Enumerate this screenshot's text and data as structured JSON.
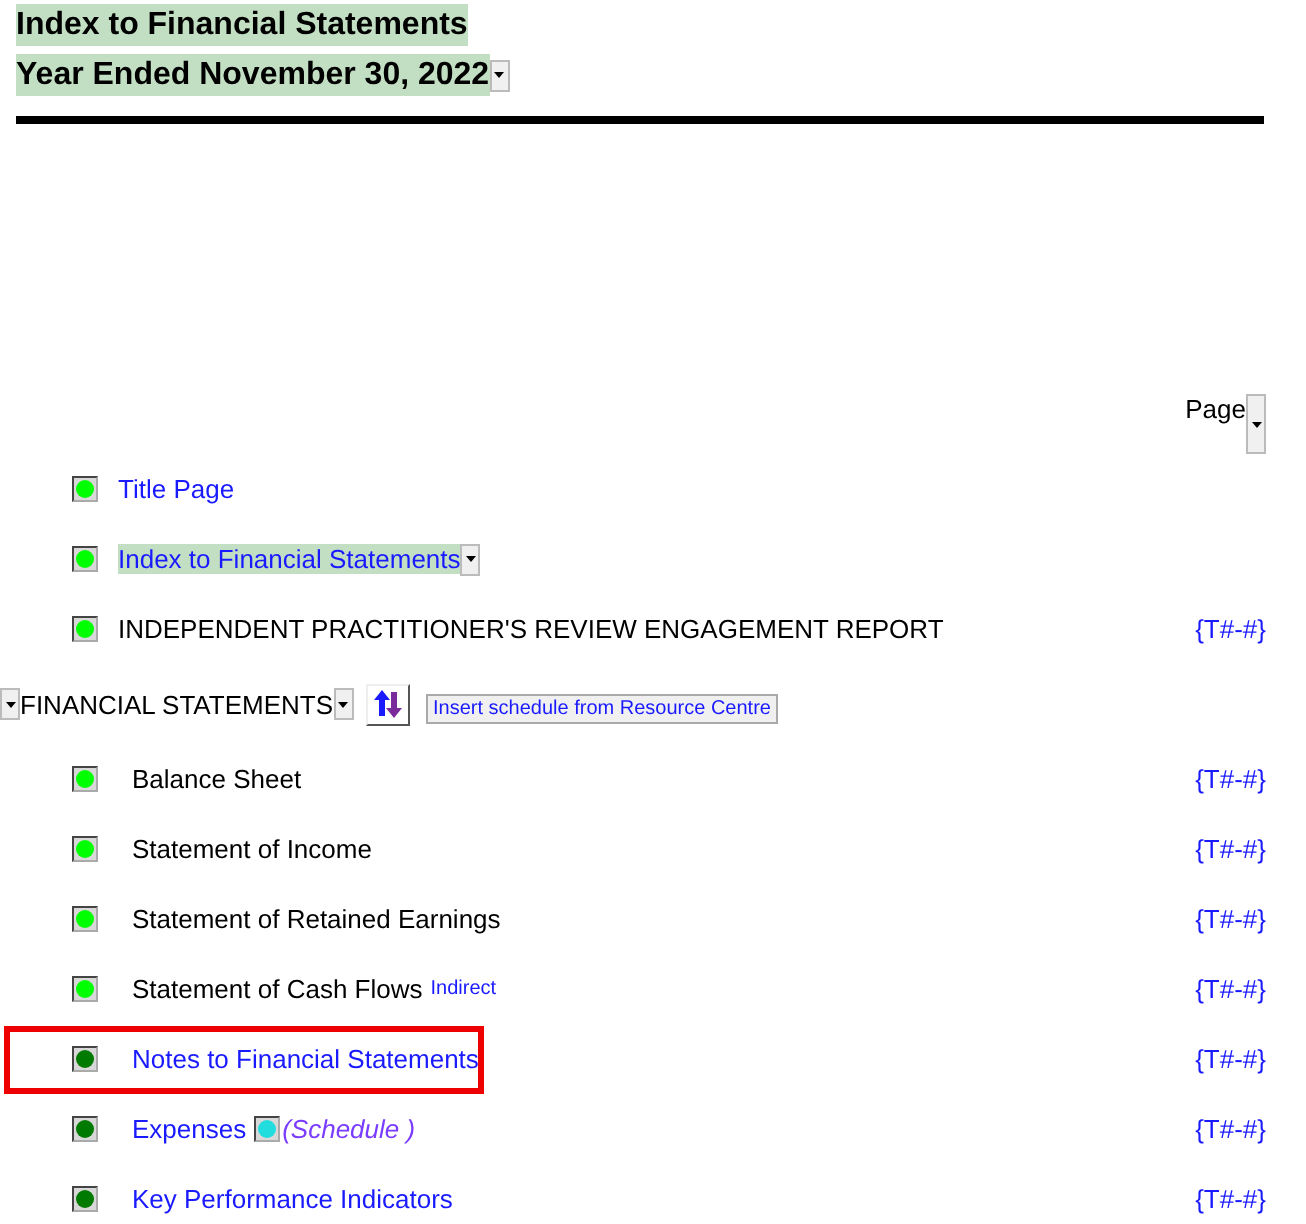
{
  "header": {
    "title": "Index to Financial Statements",
    "period": "Year Ended November 30, 2022"
  },
  "page_column": {
    "label": "Page"
  },
  "front_items": [
    {
      "label": "Title Page",
      "link": true,
      "color": "#00ff00",
      "shaded": false,
      "dropdown": false
    },
    {
      "label": "Index to Financial Statements",
      "link": true,
      "color": "#00ff00",
      "shaded": true,
      "dropdown": true
    },
    {
      "label": "INDEPENDENT PRACTITIONER'S REVIEW ENGAGEMENT REPORT",
      "link": false,
      "color": "#00ff00",
      "shaded": false,
      "dropdown": false,
      "page": "{T#-#}"
    }
  ],
  "section": {
    "title": "FINANCIAL STATEMENTS",
    "insert_button": "Insert schedule from Resource Centre"
  },
  "section_items": [
    {
      "label": "Balance Sheet",
      "link": false,
      "color": "#00ff00",
      "highlighted": false,
      "page": "{T#-#}"
    },
    {
      "label": "Statement of Income",
      "link": false,
      "color": "#00ff00",
      "highlighted": false,
      "page": "{T#-#}"
    },
    {
      "label": "Statement of Retained Earnings",
      "link": false,
      "color": "#00ff00",
      "highlighted": false,
      "page": "{T#-#}"
    },
    {
      "label": "Statement of Cash Flows",
      "link": false,
      "color": "#00ff00",
      "highlighted": false,
      "note": "Indirect",
      "page": "{T#-#}"
    },
    {
      "label": "Notes to Financial Statements",
      "link": true,
      "color": "#007a00",
      "highlighted": true,
      "page": "{T#-#}"
    },
    {
      "label": "Expenses",
      "link": true,
      "color": "#007a00",
      "highlighted": false,
      "schedule": "(Schedule )",
      "page": "{T#-#}"
    },
    {
      "label": "Key Performance Indicators",
      "link": true,
      "color": "#007a00",
      "highlighted": false,
      "page": "{T#-#}"
    }
  ]
}
